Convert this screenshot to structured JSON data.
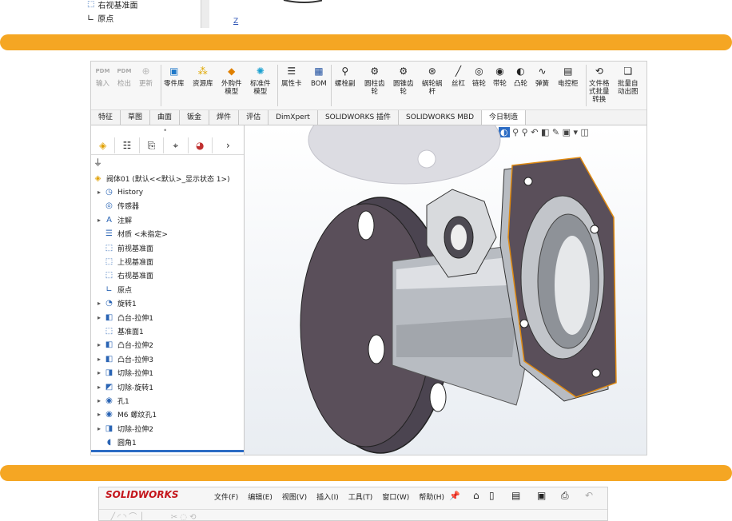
{
  "top_tree": {
    "item1": "右视基准面",
    "item2": "原点",
    "axis_label": "Z"
  },
  "ribbon": {
    "buttons": [
      {
        "label": "输入",
        "icon": "pdm-import-icon"
      },
      {
        "label": "检出",
        "icon": "pdm-checkout-icon"
      },
      {
        "label": "更新",
        "icon": "update-icon"
      },
      {
        "label": "零件库",
        "icon": "part-library-icon"
      },
      {
        "label": "资源库",
        "icon": "resource-library-icon"
      },
      {
        "label": "外购件\n模型",
        "icon": "purchased-part-icon"
      },
      {
        "label": "标准件\n模型",
        "icon": "standard-part-icon"
      },
      {
        "label": "属性卡",
        "icon": "property-card-icon"
      },
      {
        "label": "BOM",
        "icon": "bom-icon"
      },
      {
        "label": "螺栓副",
        "icon": "bolt-pair-icon"
      },
      {
        "label": "圆柱齿\n轮",
        "icon": "spur-gear-icon"
      },
      {
        "label": "圆锥齿\n轮",
        "icon": "bevel-gear-icon"
      },
      {
        "label": "蜗轮蜗\n杆",
        "icon": "worm-gear-icon"
      },
      {
        "label": "丝杠",
        "icon": "lead-screw-icon"
      },
      {
        "label": "链轮",
        "icon": "sprocket-icon"
      },
      {
        "label": "带轮",
        "icon": "pulley-icon"
      },
      {
        "label": "凸轮",
        "icon": "cam-icon"
      },
      {
        "label": "弹簧",
        "icon": "spring-icon"
      },
      {
        "label": "电控柜",
        "icon": "control-cabinet-icon"
      },
      {
        "label": "文件格\n式批量\n转换",
        "icon": "batch-convert-icon"
      },
      {
        "label": "批量自\n动出图",
        "icon": "batch-drawing-icon"
      }
    ],
    "pdm_badge": "PDM"
  },
  "tabs": [
    "特征",
    "草图",
    "曲面",
    "钣金",
    "焊件",
    "评估",
    "DimXpert",
    "SOLIDWORKS 插件",
    "SOLIDWORKS MBD",
    "今日制造"
  ],
  "tree": {
    "root": "阀体01 (默认<<默认>_显示状态 1>)",
    "items": [
      {
        "label": "History",
        "icon": "history-icon",
        "expand": true
      },
      {
        "label": "传感器",
        "icon": "sensor-icon",
        "expand": false
      },
      {
        "label": "注解",
        "icon": "annotation-icon",
        "expand": true
      },
      {
        "label": "材质 <未指定>",
        "icon": "material-icon",
        "expand": false
      },
      {
        "label": "前视基准面",
        "icon": "plane-icon",
        "expand": false
      },
      {
        "label": "上视基准面",
        "icon": "plane-icon",
        "expand": false
      },
      {
        "label": "右视基准面",
        "icon": "plane-icon",
        "expand": false
      },
      {
        "label": "原点",
        "icon": "origin-icon",
        "expand": false
      },
      {
        "label": "旋转1",
        "icon": "revolve-icon",
        "expand": true
      },
      {
        "label": "凸台-拉伸1",
        "icon": "extrude-icon",
        "expand": true
      },
      {
        "label": "基准面1",
        "icon": "plane-icon",
        "expand": false
      },
      {
        "label": "凸台-拉伸2",
        "icon": "extrude-icon",
        "expand": true
      },
      {
        "label": "凸台-拉伸3",
        "icon": "extrude-icon",
        "expand": true
      },
      {
        "label": "切除-拉伸1",
        "icon": "cut-extrude-icon",
        "expand": true
      },
      {
        "label": "切除-旋转1",
        "icon": "cut-revolve-icon",
        "expand": true
      },
      {
        "label": "孔1",
        "icon": "hole-icon",
        "expand": true
      },
      {
        "label": "M6 螺纹孔1",
        "icon": "tapped-hole-icon",
        "expand": true
      },
      {
        "label": "切除-拉伸2",
        "icon": "cut-extrude-icon",
        "expand": true
      },
      {
        "label": "圆角1",
        "icon": "fillet-icon",
        "expand": false
      }
    ]
  },
  "menubar": {
    "logo": "SOLIDWORKS",
    "items": [
      "文件(F)",
      "编辑(E)",
      "视图(V)",
      "插入(I)",
      "工具(T)",
      "窗口(W)",
      "帮助(H)"
    ]
  },
  "colors": {
    "accent": "#f5a623",
    "face": "#5a4f5a",
    "metal": "#b8bcc2",
    "edge": "#e08a10"
  }
}
